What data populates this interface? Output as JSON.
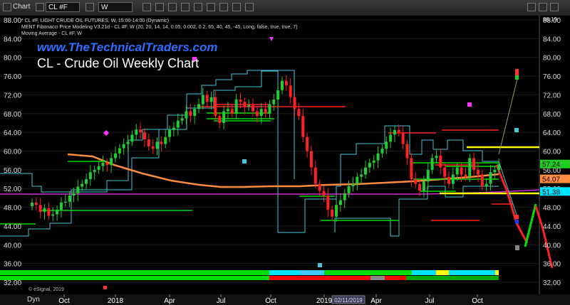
{
  "toolbar": {
    "app_label": "Chart",
    "symbol_value": "CL #F",
    "interval_value": "W",
    "dyn_label": "Dyn"
  },
  "chart_data": {
    "type": "candlestick",
    "watermark": "www.TheTechnicalTraders.com",
    "title": "CL - Crude Oil Weekly Chart",
    "info_lines": [
      "* CL #F, LIGHT CRUDE OIL FUTURES, W, 15:00-14:00 (Dynamic)",
      "MENT Fibonacci Price Modeling V3.21d - CL #F, W (20, 20, 14, 14, 0.05, 0.002, 0.2, 65, 40, 45, -45, Long, false, true, true, 7)",
      "Moving Average - CL #F, W"
    ],
    "copyright": "© eSignal, 2019",
    "y_ticks": [
      "88.00",
      "84.00",
      "80.00",
      "76.00",
      "72.00",
      "68.00",
      "64.00",
      "60.00",
      "56.00",
      "52.00",
      "48.00",
      "44.00",
      "40.00",
      "36.00",
      "32.00"
    ],
    "ylim": [
      31,
      89
    ],
    "x_ticks": [
      "Oct",
      "2018",
      "Apr",
      "Jul",
      "Oct",
      "2019",
      "Apr",
      "Jul",
      "Oct"
    ],
    "x_cursor_label": "02/11/2019",
    "price_labels": [
      {
        "value": 57.24,
        "text": "57.24",
        "color": "#22cc22"
      },
      {
        "value": 54.07,
        "text": "54.07",
        "color": "#ff8c40"
      },
      {
        "value": 51.38,
        "text": "51.38",
        "color": "#00e5ff"
      }
    ],
    "top_label": "88.19",
    "weekly_closes": [
      49.0,
      48.5,
      47.0,
      47.8,
      46.2,
      46.5,
      47.5,
      49.0,
      49.2,
      50.5,
      51.0,
      52.4,
      53.0,
      54.0,
      55.5,
      56.0,
      56.8,
      57.5,
      57.0,
      58.5,
      59.5,
      60.6,
      61.5,
      62.0,
      63.5,
      64.6,
      64.0,
      62.5,
      61.0,
      60.5,
      62.0,
      61.5,
      63.0,
      64.5,
      65.0,
      66.5,
      67.0,
      68.5,
      67.5,
      69.0,
      70.0,
      72.0,
      70.5,
      71.5,
      67.5,
      66.0,
      68.5,
      69.0,
      68.0,
      71.0,
      70.5,
      69.5,
      69.8,
      68.5,
      67.5,
      69.0,
      68.0,
      70.0,
      71.0,
      73.0,
      75.0,
      74.0,
      71.5,
      69.0,
      67.5,
      63.0,
      60.0,
      56.5,
      53.0,
      51.5,
      50.5,
      47.5,
      46.0,
      48.5,
      49.5,
      51.0,
      52.5,
      53.0,
      54.5,
      55.0,
      56.5,
      57.5,
      58.0,
      59.5,
      60.5,
      62.0,
      63.5,
      64.5,
      64.0,
      61.5,
      58.5,
      54.0,
      53.0,
      51.5,
      53.5,
      56.0,
      58.5,
      59.0,
      56.5,
      54.5,
      53.0,
      55.0,
      56.5,
      55.0,
      54.5,
      58.5,
      56.0,
      55.0,
      52.5,
      53.0,
      55.5,
      56.0,
      57.2
    ],
    "ma_orange": [
      [
        0.0,
        57.5
      ],
      [
        0.3,
        55.8
      ],
      [
        0.6,
        54.2
      ],
      [
        1.0,
        52.6
      ],
      [
        1.3,
        51.4
      ],
      [
        1.8,
        50.6
      ],
      [
        2.1,
        50.5
      ],
      [
        2.3,
        50.6
      ],
      [
        2.6,
        51.0
      ],
      [
        2.9,
        51.6
      ],
      [
        3.2,
        52.3
      ],
      [
        3.6,
        52.6
      ],
      [
        4.0,
        52.8
      ],
      [
        4.3,
        53.5
      ],
      [
        4.6,
        54.0
      ]
    ],
    "colors": {
      "up": "#22cc33",
      "down": "#ff2020",
      "orange_ma": "#ff8c40",
      "cyan": "#46c8d8",
      "magenta": "#ff33ff",
      "yellow": "#ffff00",
      "bar_green": "#00dd00",
      "bar_red": "#ff0000",
      "bar_cyan": "#00e5ff"
    }
  }
}
